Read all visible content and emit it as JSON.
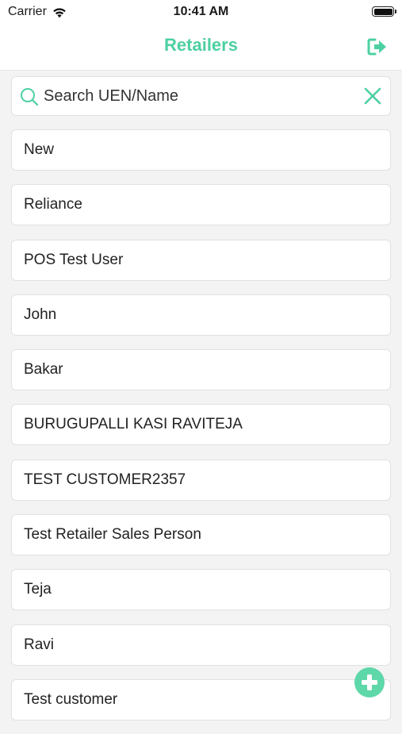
{
  "status_bar": {
    "carrier": "Carrier",
    "time": "10:41 AM"
  },
  "nav": {
    "title": "Retailers"
  },
  "search": {
    "placeholder": "Search UEN/Name",
    "value": ""
  },
  "retailers": [
    "New",
    "Reliance",
    "POS Test User",
    "John",
    "Bakar",
    "BURUGUPALLI KASI RAVITEJA",
    "TEST CUSTOMER2357",
    "Test Retailer Sales Person",
    "Teja",
    "Ravi",
    "Test customer"
  ],
  "colors": {
    "accent": "#4dd0a1",
    "fab": "#5ed7a9",
    "background": "#f3f3f3"
  },
  "icons": {
    "logout": "logout-icon",
    "search": "search-icon",
    "clear": "close-icon",
    "add": "plus-icon"
  }
}
